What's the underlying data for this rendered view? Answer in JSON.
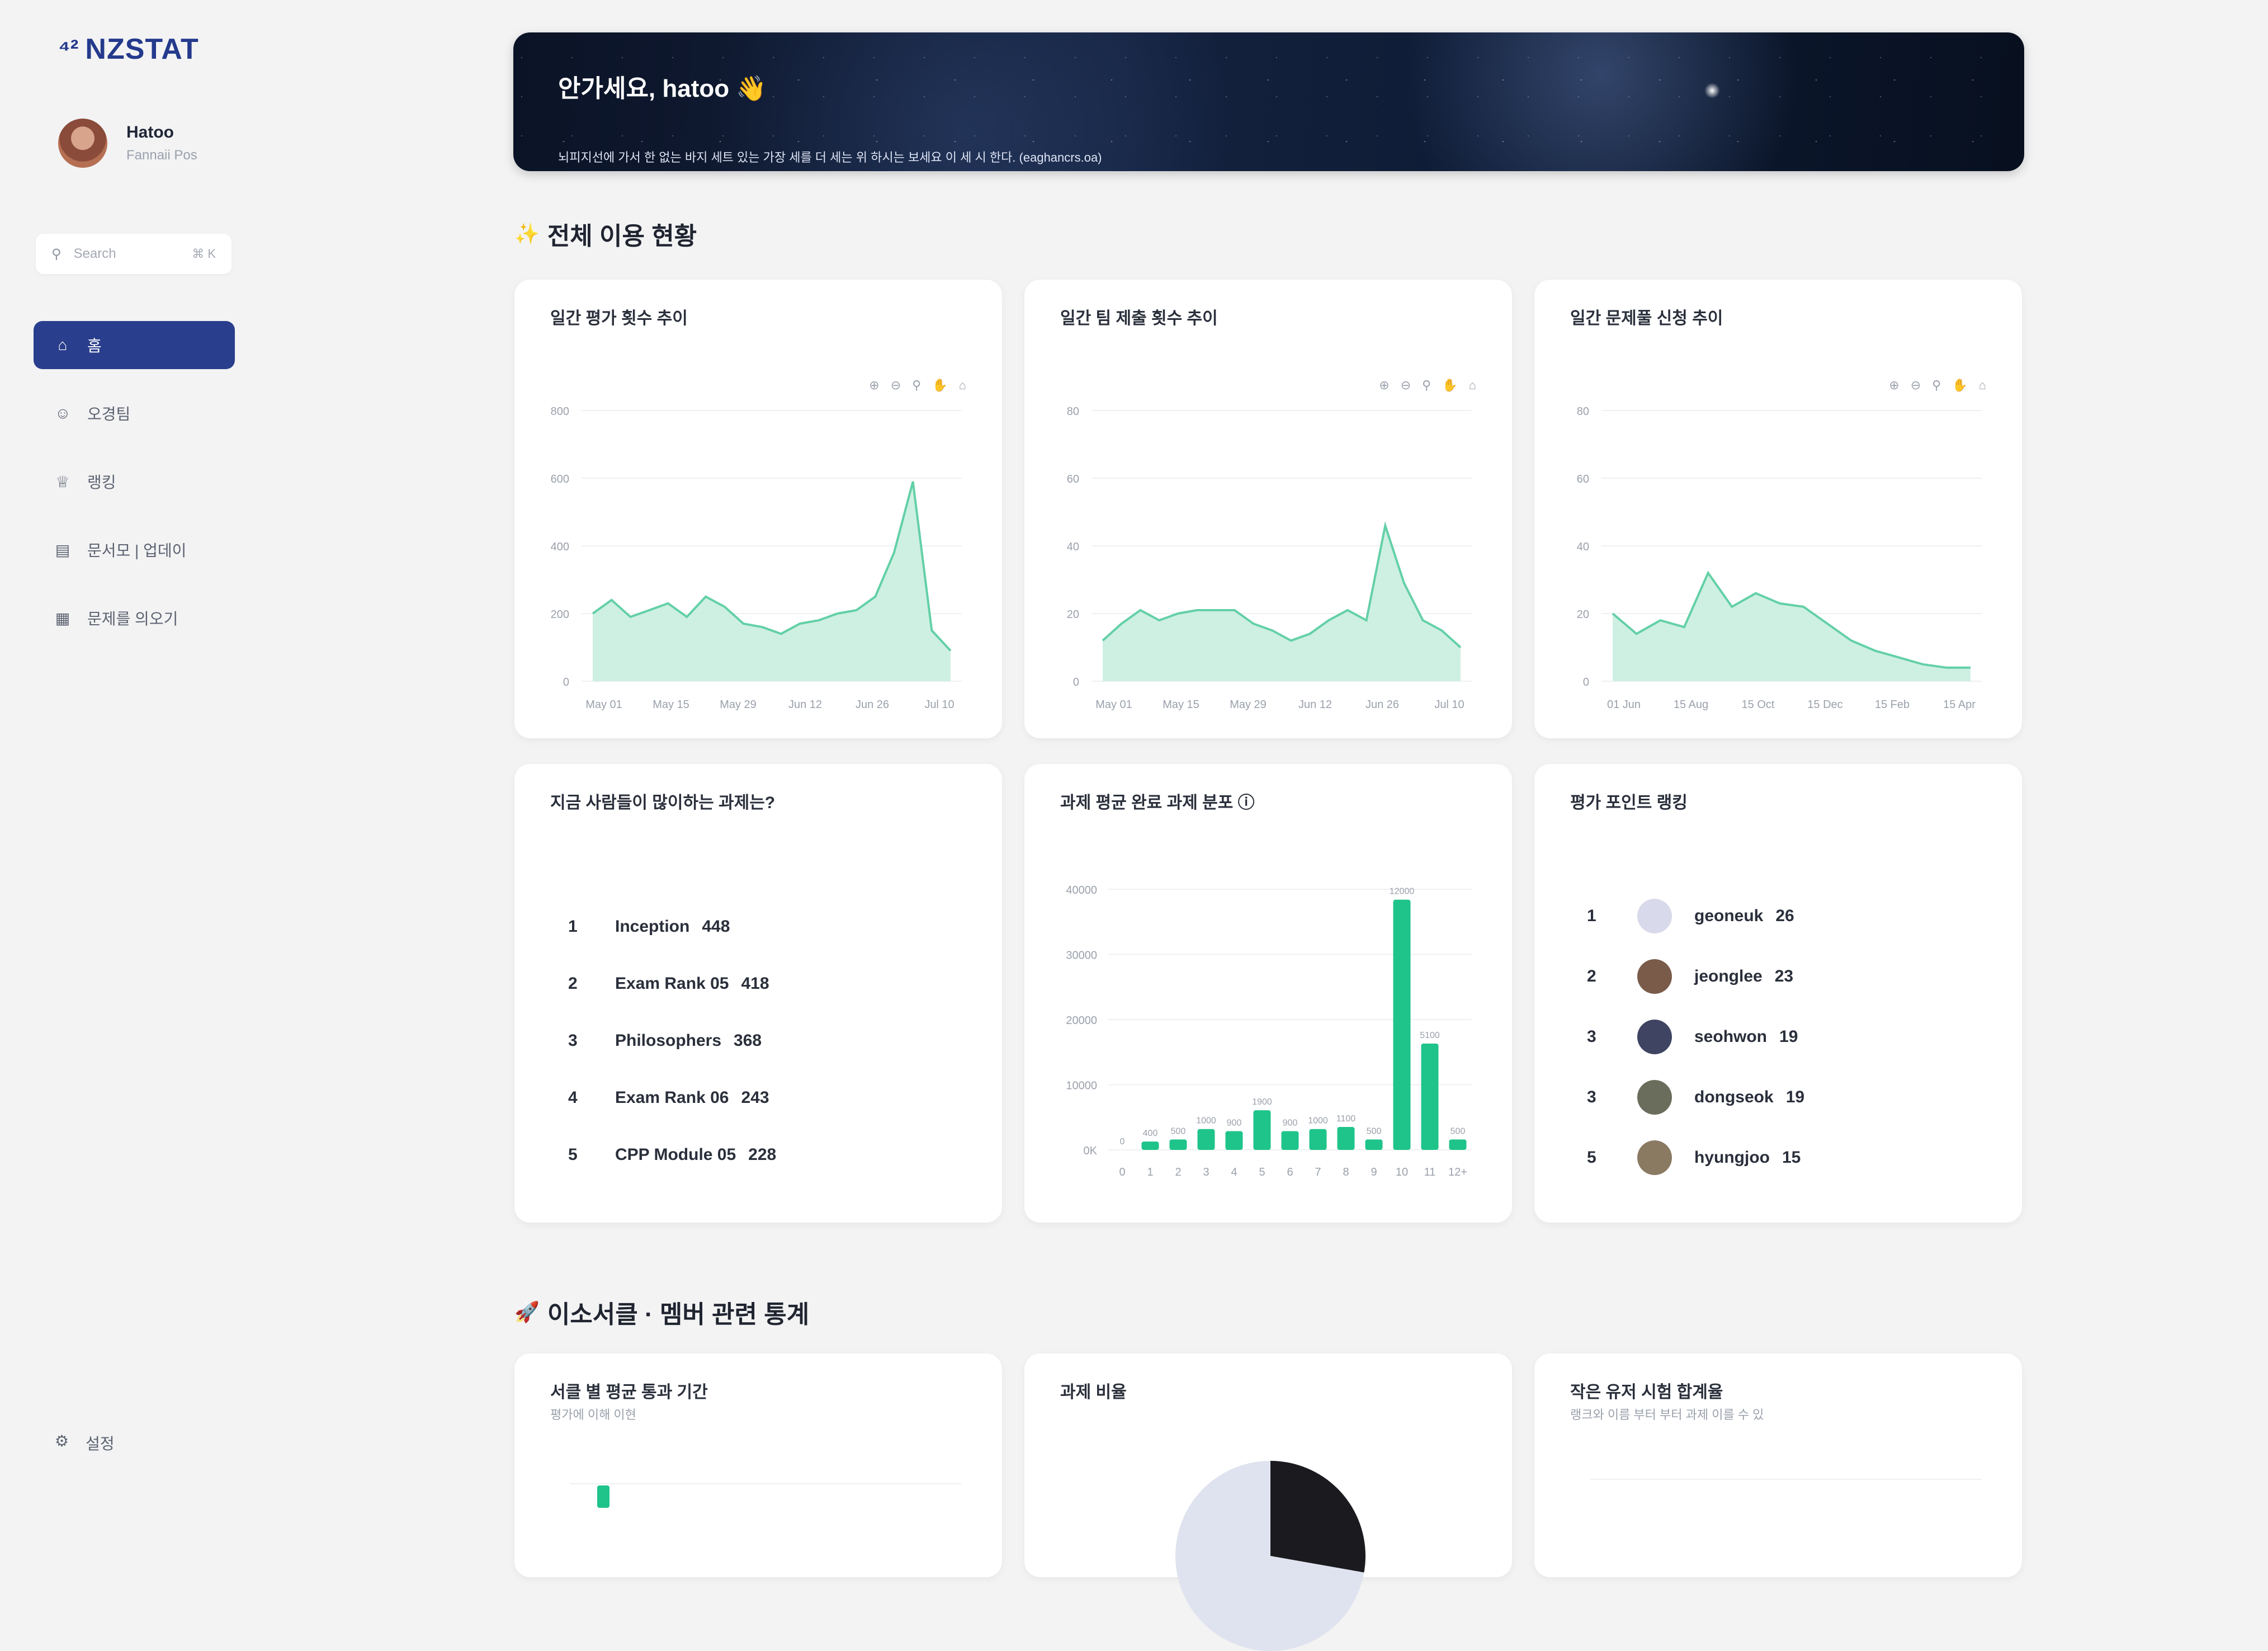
{
  "sidebar": {
    "brand": "NZSTAT",
    "profile": {
      "name": "Hatoo",
      "subtitle": "Fannaii Pos"
    },
    "search": {
      "placeholder": "Search",
      "shortcut": "⌘ K"
    },
    "items": [
      {
        "label": "홈",
        "icon": "home-icon",
        "active": true
      },
      {
        "label": "오경팀",
        "icon": "user-icon",
        "active": false
      },
      {
        "label": "랭킹",
        "icon": "trophy-icon",
        "active": false
      },
      {
        "label": "문서모 | 업데이",
        "icon": "document-icon",
        "active": false
      },
      {
        "label": "문제를 의오기",
        "icon": "book-icon",
        "active": false
      }
    ],
    "settings_label": "설정"
  },
  "banner": {
    "title": "안가세요, hatoo 👋",
    "subtitle": "뇌피지선에 가서 한 없는 바지 세트 있는 가장 세를 더 세는 위 하시는 보세요 이 세 시 한다. (eaghancrs.oa)"
  },
  "section1": {
    "title": "전체 이용 현황",
    "emoji": "✨"
  },
  "section2": {
    "title": "이소서클 · 멤버 관련 통계",
    "emoji": "🚀"
  },
  "charts": {
    "toolbar_icons": [
      "zoom-in-icon",
      "zoom-out-icon",
      "search-icon",
      "pan-icon",
      "home-icon"
    ],
    "colors": {
      "area_line": "#63d0a7",
      "area_fill": "#c9eedf",
      "bar": "#1fc48a",
      "grid": "#eef0f3",
      "axis_text": "#9aa0ab"
    }
  },
  "card1": {
    "title": "일간 평가 횟수 추이"
  },
  "card2": {
    "title": "일간 팀 제출 횟수 추이"
  },
  "card3": {
    "title": "일간 문제풀 신청 추이"
  },
  "card4": {
    "title": "지금 사람들이 많이하는 과제는?",
    "items": [
      {
        "rank": "1",
        "name": "Inception",
        "count": "448"
      },
      {
        "rank": "2",
        "name": "Exam Rank 05",
        "count": "418"
      },
      {
        "rank": "3",
        "name": "Philosophers",
        "count": "368"
      },
      {
        "rank": "4",
        "name": "Exam Rank 06",
        "count": "243"
      },
      {
        "rank": "5",
        "name": "CPP Module 05",
        "count": "228"
      }
    ]
  },
  "card5": {
    "title": "과제 평균 완료 과제 분포 ⓘ"
  },
  "card6": {
    "title": "평가 포인트 랭킹",
    "items": [
      {
        "rank": "1",
        "name": "geoneuk",
        "count": "26",
        "avatar_color": "#d8d9ea"
      },
      {
        "rank": "2",
        "name": "jeonglee",
        "count": "23",
        "avatar_color": "#7a5b4a"
      },
      {
        "rank": "3",
        "name": "seohwon",
        "count": "19",
        "avatar_color": "#3e4461"
      },
      {
        "rank": "3",
        "name": "dongseok",
        "count": "19",
        "avatar_color": "#6a6d5b"
      },
      {
        "rank": "5",
        "name": "hyungjoo",
        "count": "15",
        "avatar_color": "#8a7a62"
      }
    ]
  },
  "card7": {
    "title": "서클 별 평균 통과 기간",
    "subtitle": "평가에 이해 이현"
  },
  "card8": {
    "title": "과제 비율"
  },
  "card9": {
    "title": "작은 유저 시험 합계율",
    "subtitle": "랭크와 이름 부터 부터 과제 이를 수 있"
  },
  "chart_data": [
    {
      "type": "area",
      "title": "일간 평가 횟수 추이",
      "x": [
        "May 01",
        "May 05",
        "May 09",
        "May 13",
        "May 17",
        "May 21",
        "May 25",
        "May 29",
        "Jun 02",
        "Jun 06",
        "Jun 10",
        "Jun 14",
        "Jun 18",
        "Jun 22",
        "Jun 26",
        "Jun 30",
        "Jul 04",
        "Jul 08",
        "Jul 12",
        "Jul 16"
      ],
      "tick_labels": [
        "May 01",
        "May 15",
        "May 29",
        "Jun 12",
        "Jun 26",
        "Jul 10"
      ],
      "values": [
        200,
        240,
        190,
        210,
        230,
        190,
        250,
        220,
        170,
        160,
        140,
        170,
        180,
        200,
        210,
        250,
        380,
        590,
        150,
        90
      ],
      "y_ticks": [
        "0",
        "200",
        "400",
        "600",
        "800"
      ],
      "ylim": [
        0,
        800
      ],
      "grid": true
    },
    {
      "type": "area",
      "title": "일간 팀 제출 횟수 추이",
      "x": [
        "May 01",
        "May 05",
        "May 09",
        "May 13",
        "May 17",
        "May 21",
        "May 25",
        "May 29",
        "Jun 02",
        "Jun 06",
        "Jun 10",
        "Jun 14",
        "Jun 18",
        "Jun 22",
        "Jun 26",
        "Jun 30",
        "Jul 04",
        "Jul 08",
        "Jul 12",
        "Jul 16"
      ],
      "tick_labels": [
        "May 01",
        "May 15",
        "May 29",
        "Jun 12",
        "Jun 26",
        "Jul 10"
      ],
      "values": [
        12,
        17,
        21,
        18,
        20,
        21,
        21,
        21,
        17,
        15,
        12,
        14,
        18,
        21,
        18,
        46,
        29,
        18,
        15,
        10
      ],
      "y_ticks": [
        "0",
        "20",
        "40",
        "60",
        "80"
      ],
      "ylim": [
        0,
        80
      ],
      "grid": true
    },
    {
      "type": "area",
      "title": "일간 문제풀 신청 추이",
      "x": [
        "01 Jun",
        "05 Jun",
        "09 Jun",
        "13 Jun",
        "17 Jun",
        "21 Jun",
        "25 Jun",
        "29 Jun",
        "03 Jul",
        "07 Jul",
        "11 Jul",
        "15 Jul",
        "19 Jul",
        "23 Jul",
        "27 Jul",
        "31 Jul"
      ],
      "tick_labels": [
        "01 Jun",
        "15 Aug",
        "15 Oct",
        "15 Dec",
        "15 Feb",
        "15 Apr"
      ],
      "values": [
        20,
        14,
        18,
        16,
        32,
        22,
        26,
        23,
        22,
        17,
        12,
        9,
        7,
        5,
        4,
        4
      ],
      "y_ticks": [
        "0",
        "20",
        "40",
        "60",
        "80"
      ],
      "ylim": [
        0,
        80
      ],
      "grid": true
    },
    {
      "type": "bar",
      "title": "과제 평균 완료 과제 분포",
      "categories": [
        "0",
        "1",
        "2",
        "3",
        "4",
        "5",
        "6",
        "7",
        "8",
        "9",
        "10",
        "11",
        "12+"
      ],
      "values": [
        0,
        400,
        500,
        1000,
        900,
        1900,
        900,
        1000,
        1100,
        500,
        12000,
        5100,
        500
      ],
      "y_ticks": [
        "0K",
        "10000",
        "20000",
        "30000",
        "40000"
      ],
      "ylim": [
        0,
        12500
      ],
      "grid": true
    }
  ]
}
